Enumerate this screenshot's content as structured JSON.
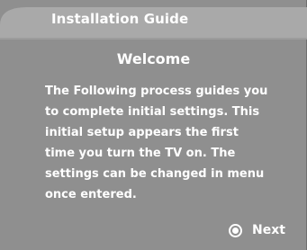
{
  "header": {
    "title": "Installation Guide"
  },
  "dialog": {
    "title": "Welcome",
    "lines": [
      "The Following process guides you",
      "to complete initial settings. This",
      "initial setup appears the first",
      "time you turn the TV on. The",
      "settings can be changed in menu",
      "once entered."
    ]
  },
  "actions": {
    "next_label": "Next",
    "next_icon": "radio-select-icon"
  },
  "colors": {
    "panel": "#8f8f8f",
    "header": "#a9a9a9",
    "text": "#ffffff"
  }
}
